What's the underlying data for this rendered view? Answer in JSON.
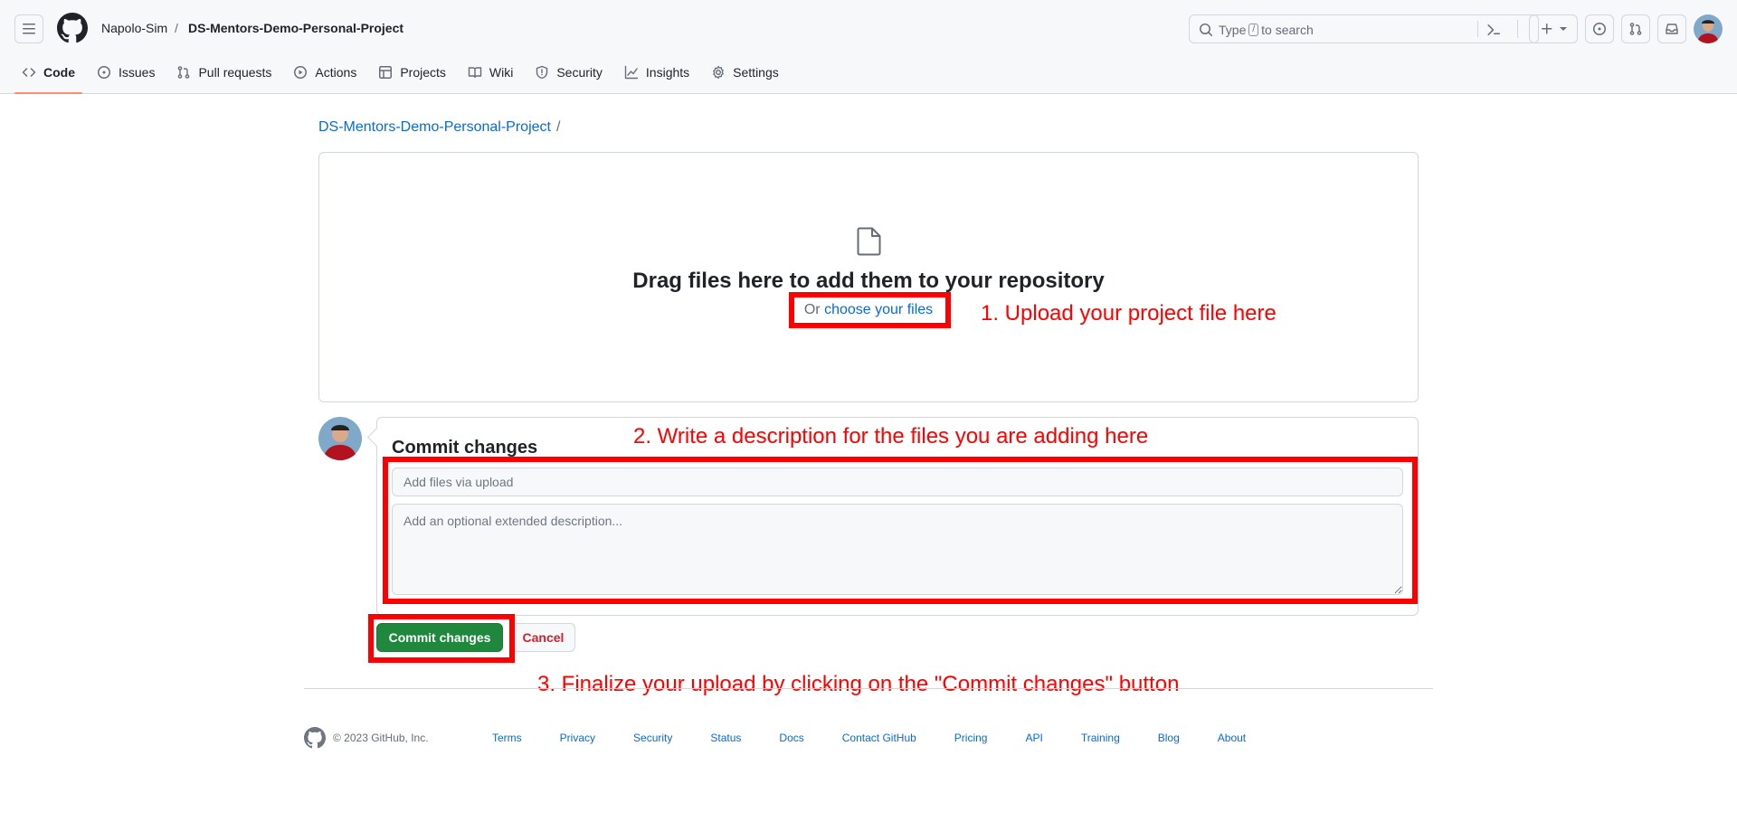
{
  "header": {
    "owner": "Napolo-Sim",
    "separator": "/",
    "repo": "DS-Mentors-Demo-Personal-Project",
    "search_prefix": "Type",
    "search_key": "/",
    "search_suffix": "to search"
  },
  "tabs": [
    {
      "label": "Code",
      "icon": "code-icon",
      "active": true
    },
    {
      "label": "Issues",
      "icon": "issue-opened-icon"
    },
    {
      "label": "Pull requests",
      "icon": "git-pull-request-icon"
    },
    {
      "label": "Actions",
      "icon": "play-icon"
    },
    {
      "label": "Projects",
      "icon": "table-icon"
    },
    {
      "label": "Wiki",
      "icon": "book-icon"
    },
    {
      "label": "Security",
      "icon": "shield-icon"
    },
    {
      "label": "Insights",
      "icon": "graph-icon"
    },
    {
      "label": "Settings",
      "icon": "gear-icon"
    }
  ],
  "breadcrumb": {
    "repo": "DS-Mentors-Demo-Personal-Project",
    "separator": "/"
  },
  "upload": {
    "title": "Drag files here to add them to your repository",
    "or_text": "Or",
    "choose_link": "choose your files"
  },
  "commit": {
    "title": "Commit changes",
    "summary_placeholder": "Add files via upload",
    "description_placeholder": "Add an optional extended description...",
    "commit_button": "Commit changes",
    "cancel_button": "Cancel"
  },
  "annotations": {
    "step1": "1. Upload your project file here",
    "step2": "2. Write a description for the files you are adding here",
    "step3": "3. Finalize your upload by clicking on the \"Commit changes\" button",
    "color": "#ff0000"
  },
  "footer": {
    "copyright": "© 2023 GitHub, Inc.",
    "links": [
      "Terms",
      "Privacy",
      "Security",
      "Status",
      "Docs",
      "Contact GitHub",
      "Pricing",
      "API",
      "Training",
      "Blog",
      "About"
    ]
  },
  "colors": {
    "accent": "#0969da",
    "primary_button": "#1f883d",
    "danger": "#cf222e",
    "tab_underline": "#fd8c73"
  }
}
